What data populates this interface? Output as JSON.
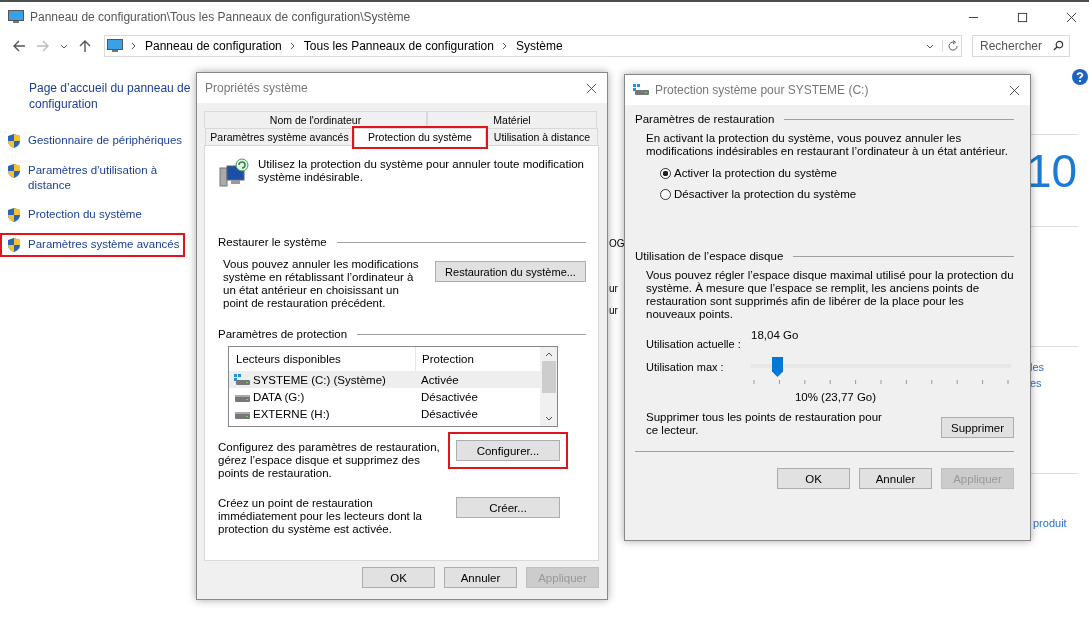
{
  "window": {
    "title": "Panneau de configuration\\Tous les Panneaux de configuration\\Système"
  },
  "address_bar": {
    "crumbs": [
      "Panneau de configuration",
      "Tous les Panneaux de configuration",
      "Système"
    ]
  },
  "search": {
    "placeholder": "Rechercher"
  },
  "sidebar": {
    "home_link": "Page d’accueil du panneau de configuration",
    "items": [
      {
        "label": "Gestionnaire de périphériques",
        "highlighted": false
      },
      {
        "label": "Paramètres d’utilisation à distance",
        "highlighted": false
      },
      {
        "label": "Protection du système",
        "highlighted": false
      },
      {
        "label": "Paramètres système avancés",
        "highlighted": true
      }
    ]
  },
  "background_fragments": [
    {
      "text": "OG"
    },
    {
      "text": "ur"
    },
    {
      "text": "ur"
    },
    {
      "text": "10"
    },
    {
      "text": "les"
    },
    {
      "text": "es"
    },
    {
      "text": "produit"
    }
  ],
  "system_properties": {
    "title": "Propriétés système",
    "tab_rows": [
      [
        {
          "label": "Nom de l'ordinateur",
          "selected": false,
          "highlighted": false
        },
        {
          "label": "Matériel",
          "selected": false,
          "highlighted": false
        }
      ],
      [
        {
          "label": "Paramètres système avancés",
          "selected": false,
          "highlighted": false
        },
        {
          "label": "Protection du système",
          "selected": true,
          "highlighted": true
        },
        {
          "label": "Utilisation à distance",
          "selected": false,
          "highlighted": false
        }
      ]
    ],
    "intro": "Utilisez la protection du système pour annuler toute modification système indésirable.",
    "restore": {
      "heading": "Restaurer le système",
      "text": "Vous pouvez annuler les modifications système en rétablissant l’ordinateur à un état antérieur en choisissant un point de restauration précédent.",
      "button": "Restauration du système..."
    },
    "protection": {
      "heading": "Paramètres de protection",
      "columns": [
        "Lecteurs disponibles",
        "Protection"
      ],
      "drives": [
        {
          "name": "SYSTEME (C:) (Système)",
          "protection": "Activée",
          "kind": "system",
          "selected": true
        },
        {
          "name": "DATA (G:)",
          "protection": "Désactivée",
          "kind": "disk",
          "selected": false
        },
        {
          "name": "EXTERNE (H:)",
          "protection": "Désactivée",
          "kind": "disk",
          "selected": false
        }
      ]
    },
    "configure": {
      "text": "Configurez des paramètres de restauration, gérez l’espace disque et supprimez des points de restauration.",
      "button": "Configurer...",
      "highlighted": true
    },
    "create": {
      "text": "Créez un point de restauration immédiatement pour les lecteurs dont la protection du système est activée.",
      "button": "Créer..."
    },
    "buttons": [
      {
        "label": "OK",
        "disabled": false
      },
      {
        "label": "Annuler",
        "disabled": false
      },
      {
        "label": "Appliquer",
        "disabled": true
      }
    ]
  },
  "drive_protection": {
    "title": "Protection système pour SYSTEME (C:)",
    "restore_settings": {
      "heading": "Paramètres de restauration",
      "text": "En activant la protection du système, vous pouvez annuler les modifications indésirables en restaurant l’ordinateur à un état antérieur.",
      "options": [
        {
          "label": "Activer la protection du système",
          "selected": true
        },
        {
          "label": "Désactiver la protection du système",
          "selected": false
        }
      ]
    },
    "disk_usage": {
      "heading": "Utilisation de l’espace disque",
      "text": "Vous pouvez régler l’espace disque maximal utilisé pour la protection du système. À mesure que l’espace se remplit, les anciens points de restauration sont supprimés afin de libérer de la place pour les nouveaux points.",
      "current_label": "Utilisation actuelle :",
      "current_value": "18,04 Go",
      "max_label": "Utilisation max :",
      "level": 0.1,
      "max_reading": "10% (23,77 Go)",
      "delete_text": "Supprimer tous les points de restauration pour ce lecteur.",
      "delete_button": "Supprimer"
    },
    "buttons": [
      {
        "label": "OK",
        "disabled": false
      },
      {
        "label": "Annuler",
        "disabled": false
      },
      {
        "label": "Appliquer",
        "disabled": true
      }
    ]
  }
}
